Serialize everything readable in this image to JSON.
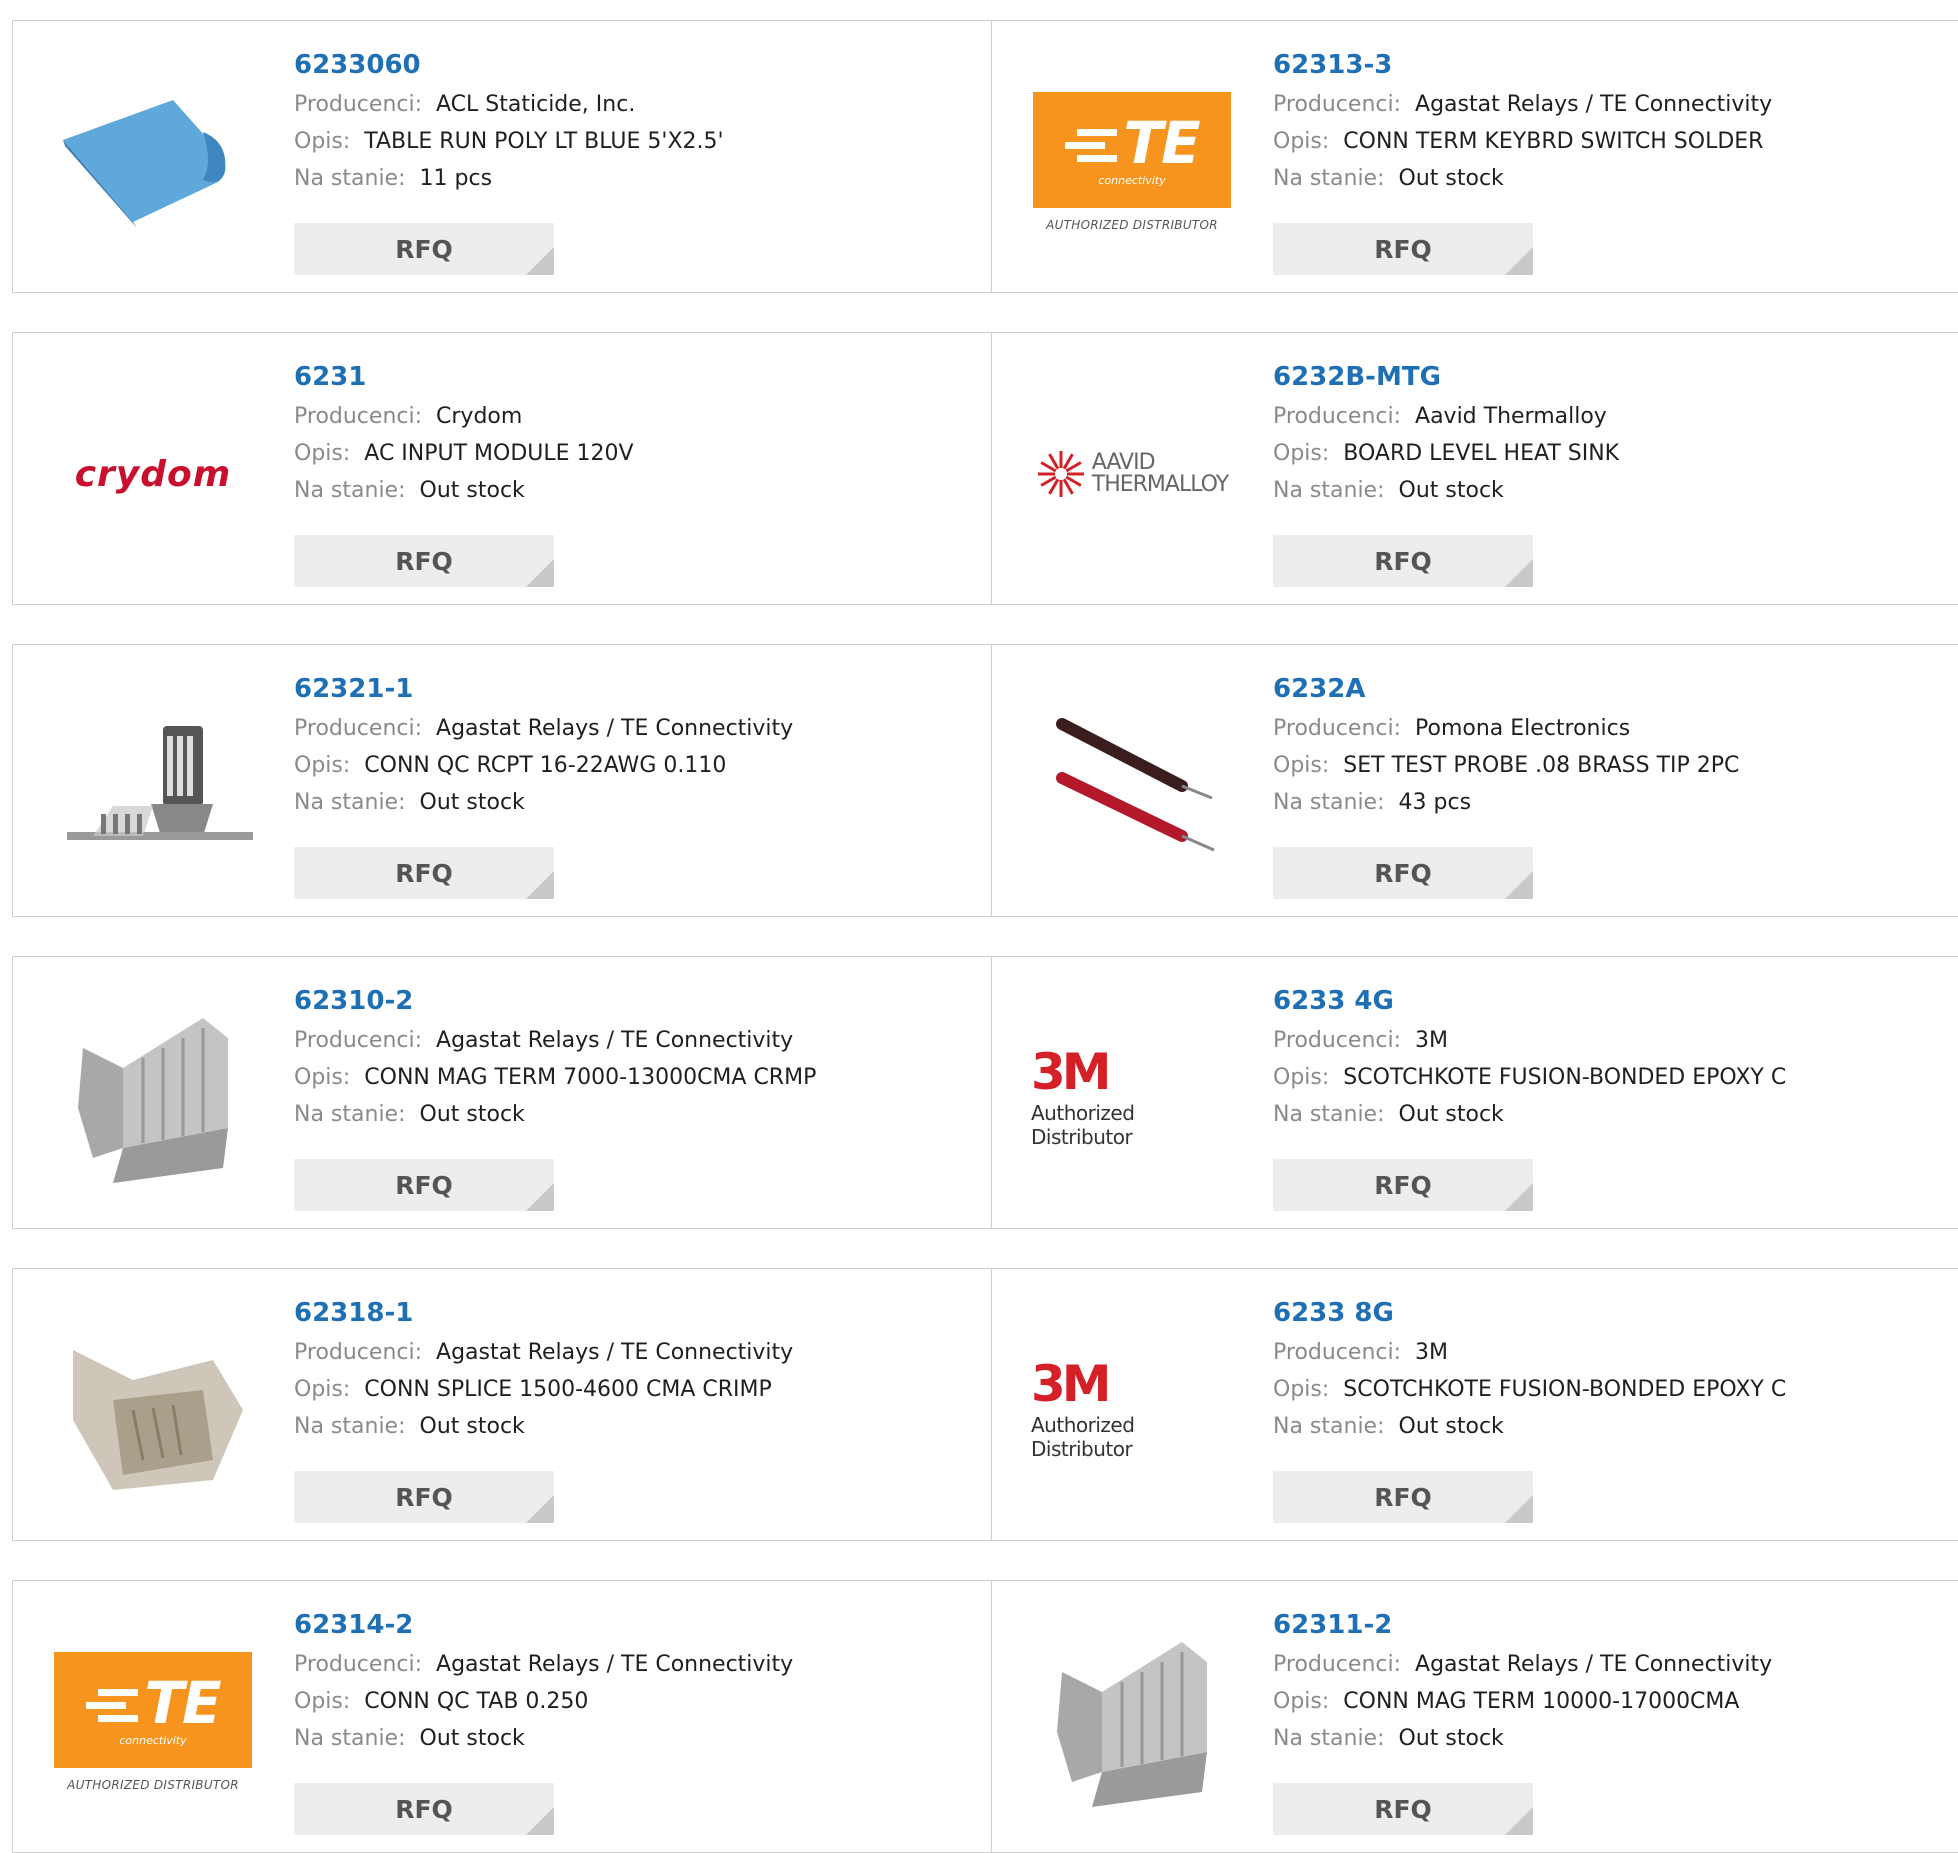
{
  "labels": {
    "manufacturer": "Producenci:",
    "description": "Opis:",
    "stock": "Na stanie:",
    "rfq": "RFQ"
  },
  "products": [
    {
      "pn": "6233060",
      "manufacturer": "ACL Staticide, Inc.",
      "description": "TABLE RUN POLY LT BLUE 5'X2.5'",
      "stock": "11 pcs",
      "image": "blue-mat"
    },
    {
      "pn": "62313-3",
      "manufacturer": "Agastat Relays / TE Connectivity",
      "description": "CONN TERM KEYBRD SWITCH SOLDER",
      "stock": "Out stock",
      "image": "te-logo"
    },
    {
      "pn": "6231",
      "manufacturer": "Crydom",
      "description": "AC INPUT MODULE 120V",
      "stock": "Out stock",
      "image": "crydom-logo"
    },
    {
      "pn": "6232B-MTG",
      "manufacturer": "Aavid Thermalloy",
      "description": "BOARD LEVEL HEAT SINK",
      "stock": "Out stock",
      "image": "aavid-logo"
    },
    {
      "pn": "62321-1",
      "manufacturer": "Agastat Relays / TE Connectivity",
      "description": "CONN QC RCPT 16-22AWG 0.110",
      "stock": "Out stock",
      "image": "connector-photo"
    },
    {
      "pn": "6232A",
      "manufacturer": "Pomona Electronics",
      "description": "SET TEST PROBE .08 BRASS TIP 2PC",
      "stock": "43 pcs",
      "image": "probes-photo"
    },
    {
      "pn": "62310-2",
      "manufacturer": "Agastat Relays / TE Connectivity",
      "description": "CONN MAG TERM 7000-13000CMA CRMP",
      "stock": "Out stock",
      "image": "terminal-photo"
    },
    {
      "pn": "6233 4G",
      "manufacturer": "3M",
      "description": "SCOTCHKOTE FUSION-BONDED EPOXY C",
      "stock": "Out stock",
      "image": "3m-logo"
    },
    {
      "pn": "62318-1",
      "manufacturer": "Agastat Relays / TE Connectivity",
      "description": "CONN SPLICE 1500-4600 CMA CRIMP",
      "stock": "Out stock",
      "image": "splice-photo"
    },
    {
      "pn": "6233 8G",
      "manufacturer": "3M",
      "description": "SCOTCHKOTE FUSION-BONDED EPOXY C",
      "stock": "Out stock",
      "image": "3m-logo"
    },
    {
      "pn": "62314-2",
      "manufacturer": "Agastat Relays / TE Connectivity",
      "description": "CONN QC TAB 0.250",
      "stock": "Out stock",
      "image": "te-logo"
    },
    {
      "pn": "62311-2",
      "manufacturer": "Agastat Relays / TE Connectivity",
      "description": "CONN MAG TERM 10000-17000CMA",
      "stock": "Out stock",
      "image": "terminal-photo"
    }
  ],
  "logos": {
    "te": {
      "mark": "TE",
      "sub": "connectivity",
      "dist": "AUTHORIZED DISTRIBUTOR"
    },
    "crydom": "crydom",
    "aavid": [
      "AAVID",
      "THERMALLOY"
    ],
    "m3": {
      "mark": "3M",
      "dist": "Authorized Distributor"
    }
  },
  "colors": {
    "part_number": "#1f6fb5",
    "label": "#8a8a8a",
    "value": "#1f1f1f",
    "rfq_bg": "#ededed",
    "te_orange": "#f7941d",
    "crydom_red": "#c8102e",
    "m3_red": "#d62027"
  }
}
